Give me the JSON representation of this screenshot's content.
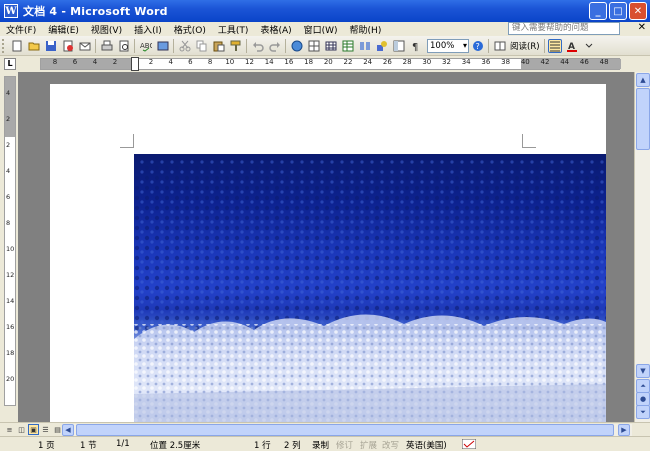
{
  "window": {
    "title": "文档 4 - Microsoft Word",
    "icon_glyph": "W",
    "minimize_glyph": "_",
    "maximize_glyph": "□",
    "close_glyph": "✕"
  },
  "menu": {
    "items": [
      "文件(F)",
      "编辑(E)",
      "视图(V)",
      "插入(I)",
      "格式(O)",
      "工具(T)",
      "表格(A)",
      "窗口(W)",
      "帮助(H)"
    ],
    "help_placeholder": "键入需要帮助的问题",
    "close_glyph": "✕"
  },
  "toolbar": {
    "zoom": "100%",
    "read_label": "阅读(R)"
  },
  "ruler": {
    "corner_glyph": "L",
    "numbers": [
      "8",
      "6",
      "4",
      "2",
      "2",
      "4",
      "6",
      "8",
      "10",
      "12",
      "14",
      "16",
      "18",
      "20",
      "22",
      "24",
      "26",
      "28",
      "30",
      "32",
      "34",
      "36",
      "38",
      "40",
      "42",
      "44",
      "46",
      "48"
    ],
    "vnumbers": [
      "4",
      "2",
      "2",
      "4",
      "6",
      "8",
      "10",
      "12",
      "14",
      "16",
      "18",
      "20"
    ]
  },
  "statusbar": {
    "page": "1 页",
    "section": "1 节",
    "page_of": "1/1",
    "position": "位置 2.5厘米",
    "line": "1 行",
    "column": "2 列",
    "rec": "录制",
    "trk": "修订",
    "ext": "扩展",
    "ovr": "改写",
    "language": "英语(美国)"
  },
  "colors": {
    "titlebar": "#0a44c8",
    "chrome": "#ece9d8",
    "workspace": "#808080",
    "photo_sky": "#0d2290",
    "photo_snow": "#e6ecfa"
  }
}
